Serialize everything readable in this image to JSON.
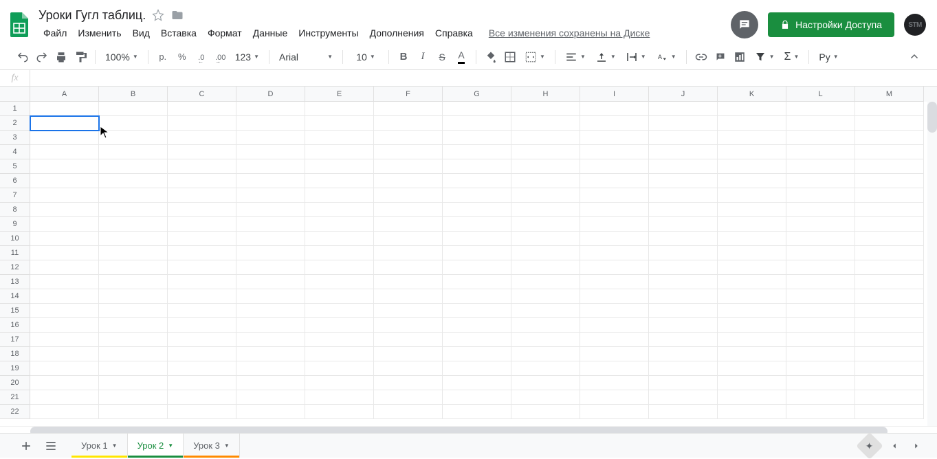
{
  "doc": {
    "title": "Уроки Гугл таблиц."
  },
  "menus": [
    "Файл",
    "Изменить",
    "Вид",
    "Вставка",
    "Формат",
    "Данные",
    "Инструменты",
    "Дополнения",
    "Справка"
  ],
  "save_status": "Все изменения сохранены на Диске",
  "share_label": "Настройки Доступа",
  "avatar_text": "STM",
  "toolbar": {
    "zoom": "100%",
    "currency": "р.",
    "percent": "%",
    "dec_dec": ".0",
    "inc_dec": ".00",
    "more_formats": "123",
    "font": "Arial",
    "font_size": "10",
    "lang_chip": "Ру"
  },
  "columns": [
    "A",
    "B",
    "C",
    "D",
    "E",
    "F",
    "G",
    "H",
    "I",
    "J",
    "K",
    "L",
    "M"
  ],
  "rows": [
    1,
    2,
    3,
    4,
    5,
    6,
    7,
    8,
    9,
    10,
    11,
    12,
    13,
    14,
    15,
    16,
    17,
    18,
    19,
    20,
    21,
    22
  ],
  "active_cell": "A2",
  "sheets": [
    {
      "name": "Урок 1",
      "active": false,
      "color": "c1"
    },
    {
      "name": "Урок 2",
      "active": true,
      "color": ""
    },
    {
      "name": "Урок 3",
      "active": false,
      "color": "c3"
    }
  ]
}
